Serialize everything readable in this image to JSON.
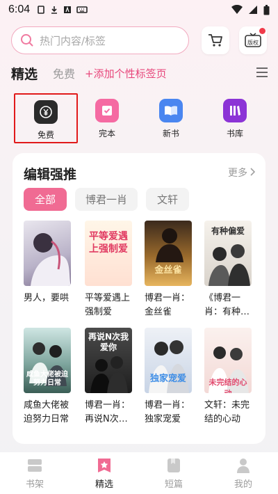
{
  "status": {
    "time": "6:04"
  },
  "search": {
    "placeholder": "热门内容/标签",
    "gift_label": "版权"
  },
  "tabs": {
    "active": "精选",
    "other": "免费",
    "add": "+添加个性标签页"
  },
  "categories": [
    {
      "label": "免费",
      "color": "#2b2b2b",
      "icon": "yen-coin-icon"
    },
    {
      "label": "完本",
      "color": "#f56aa2",
      "icon": "check-box-icon"
    },
    {
      "label": "新书",
      "color": "#4a86f0",
      "icon": "open-book-icon"
    },
    {
      "label": "书库",
      "color": "#8c34d6",
      "icon": "library-icon"
    }
  ],
  "panel": {
    "title": "编辑强推",
    "more": "更多",
    "chips": [
      "全部",
      "博君一肖",
      "文轩"
    ]
  },
  "books": [
    {
      "title": "男人，要哄",
      "cover_text": ""
    },
    {
      "title": "平等爱遇上强制爱",
      "cover_text": "平等爱遇上强制爱"
    },
    {
      "title": "博君一肖：金丝雀",
      "cover_text": "金丝雀"
    },
    {
      "title": "《博君一肖：有种…",
      "cover_text": "有种偏爱"
    },
    {
      "title": "咸鱼大佬被迫努力日常",
      "cover_text": "咸鱼大佬被迫努力日常"
    },
    {
      "title": "博君一肖：再说N次…",
      "cover_text": "再说N次我爱你"
    },
    {
      "title": "博君一肖：独家宠爱",
      "cover_text": "独家宠爱"
    },
    {
      "title": "文轩：未完结的心动",
      "cover_text": "未完结的心动"
    }
  ],
  "nav": [
    {
      "label": "书架",
      "icon": "bookshelf-icon"
    },
    {
      "label": "精选",
      "icon": "star-icon"
    },
    {
      "label": "短篇",
      "icon": "short-story-icon"
    },
    {
      "label": "我的",
      "icon": "profile-icon"
    }
  ],
  "colors": {
    "accent": "#f06b93",
    "highlight_border": "#e11a1a",
    "dot": "#f03a4a"
  }
}
